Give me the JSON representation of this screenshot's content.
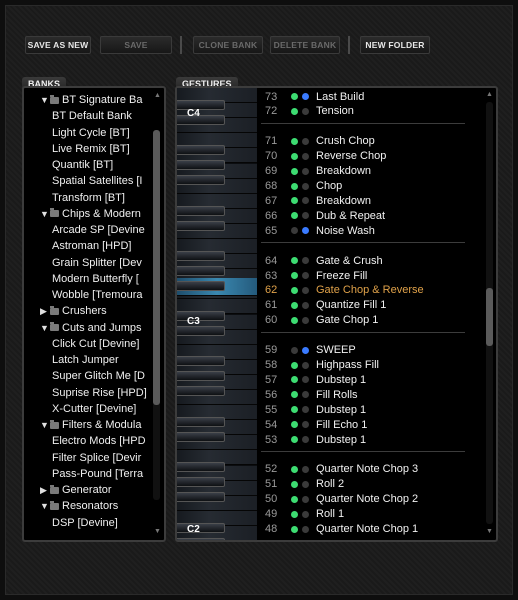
{
  "toolbar": {
    "save_as_new": "SAVE AS NEW",
    "save": "SAVE",
    "clone_bank": "CLONE BANK",
    "delete_bank": "DELETE BANK",
    "new_folder": "NEW FOLDER"
  },
  "banks": {
    "tab": "BANKS",
    "items": [
      {
        "label": "BT Signature Ba",
        "type": "folder",
        "state": "expanded"
      },
      {
        "label": "BT Default Bank",
        "type": "item"
      },
      {
        "label": "Light Cycle [BT]",
        "type": "item"
      },
      {
        "label": "Live Remix [BT]",
        "type": "item"
      },
      {
        "label": "Quantik [BT]",
        "type": "item"
      },
      {
        "label": "Spatial Satellites [I",
        "type": "item"
      },
      {
        "label": "Transform [BT]",
        "type": "item"
      },
      {
        "label": "Chips & Modern",
        "type": "folder",
        "state": "expanded"
      },
      {
        "label": "Arcade SP [Devine",
        "type": "item"
      },
      {
        "label": "Astroman [HPD]",
        "type": "item"
      },
      {
        "label": "Grain Splitter [Dev",
        "type": "item"
      },
      {
        "label": "Modern Butterfly [",
        "type": "item"
      },
      {
        "label": "Wobble [Tremoura",
        "type": "item"
      },
      {
        "label": "Crushers",
        "type": "folder",
        "state": "collapsed"
      },
      {
        "label": "Cuts and Jumps",
        "type": "folder",
        "state": "expanded"
      },
      {
        "label": "Click Cut [Devine]",
        "type": "item"
      },
      {
        "label": "Latch Jumper",
        "type": "item"
      },
      {
        "label": "Super Glitch Me [D",
        "type": "item"
      },
      {
        "label": "Suprise Rise [HPD]",
        "type": "item"
      },
      {
        "label": "X-Cutter [Devine]",
        "type": "item"
      },
      {
        "label": "Filters & Modula",
        "type": "folder",
        "state": "expanded"
      },
      {
        "label": "Electro Mods [HPD",
        "type": "item"
      },
      {
        "label": "Filter Splice [Devir",
        "type": "item"
      },
      {
        "label": "Pass-Pound [Terra",
        "type": "item"
      },
      {
        "label": "Generator",
        "type": "folder",
        "state": "collapsed"
      },
      {
        "label": "Resonators",
        "type": "folder",
        "state": "expanded"
      },
      {
        "label": "DSP [Devine]",
        "type": "item"
      }
    ]
  },
  "gestures": {
    "tab": "GESTURES",
    "key_labels": {
      "c4": "C4",
      "c3": "C3",
      "c2": "C2"
    },
    "rows": [
      {
        "num": "73",
        "name": "Last Build",
        "dots": [
          "green",
          "blue"
        ]
      },
      {
        "num": "72",
        "name": "Tension",
        "dots": [
          "green",
          "gray"
        ]
      },
      {
        "num": "71",
        "name": "Crush Chop",
        "dots": [
          "green",
          "gray"
        ]
      },
      {
        "num": "70",
        "name": "Reverse Chop",
        "dots": [
          "green",
          "gray"
        ]
      },
      {
        "num": "69",
        "name": "Breakdown",
        "dots": [
          "green",
          "gray"
        ]
      },
      {
        "num": "68",
        "name": "Chop",
        "dots": [
          "green",
          "gray"
        ]
      },
      {
        "num": "67",
        "name": "Breakdown",
        "dots": [
          "green",
          "gray"
        ]
      },
      {
        "num": "66",
        "name": "Dub & Repeat",
        "dots": [
          "green",
          "gray"
        ]
      },
      {
        "num": "65",
        "name": "Noise Wash",
        "dots": [
          "gray",
          "blue"
        ]
      },
      {
        "num": "64",
        "name": "Gate & Crush",
        "dots": [
          "green",
          "gray"
        ]
      },
      {
        "num": "63",
        "name": "Freeze Fill",
        "dots": [
          "green",
          "gray"
        ]
      },
      {
        "num": "62",
        "name": "Gate Chop & Reverse",
        "dots": [
          "green",
          "gray"
        ],
        "selected": true
      },
      {
        "num": "61",
        "name": "Quantize Fill 1",
        "dots": [
          "green",
          "gray"
        ]
      },
      {
        "num": "60",
        "name": "Gate Chop 1",
        "dots": [
          "green",
          "gray"
        ]
      },
      {
        "num": "59",
        "name": "SWEEP",
        "dots": [
          "gray",
          "blue"
        ]
      },
      {
        "num": "58",
        "name": "Highpass Fill",
        "dots": [
          "green",
          "gray"
        ]
      },
      {
        "num": "57",
        "name": "Dubstep 1",
        "dots": [
          "green",
          "gray"
        ]
      },
      {
        "num": "56",
        "name": "Fill Rolls",
        "dots": [
          "green",
          "gray"
        ]
      },
      {
        "num": "55",
        "name": "Dubstep 1",
        "dots": [
          "green",
          "gray"
        ]
      },
      {
        "num": "54",
        "name": "Fill Echo 1",
        "dots": [
          "green",
          "gray"
        ]
      },
      {
        "num": "53",
        "name": "Dubstep 1",
        "dots": [
          "green",
          "gray"
        ]
      },
      {
        "num": "52",
        "name": "Quarter Note Chop 3",
        "dots": [
          "green",
          "gray"
        ]
      },
      {
        "num": "51",
        "name": "Roll 2",
        "dots": [
          "green",
          "gray"
        ]
      },
      {
        "num": "50",
        "name": "Quarter Note Chop 2",
        "dots": [
          "green",
          "gray"
        ]
      },
      {
        "num": "49",
        "name": "Roll 1",
        "dots": [
          "green",
          "gray"
        ]
      },
      {
        "num": "48",
        "name": "Quarter Note Chop 1",
        "dots": [
          "green",
          "gray"
        ]
      }
    ]
  },
  "colors": {
    "accent_selected": "#e0a24a",
    "dot_green": "#3ddc72",
    "dot_blue": "#3a7bff"
  }
}
